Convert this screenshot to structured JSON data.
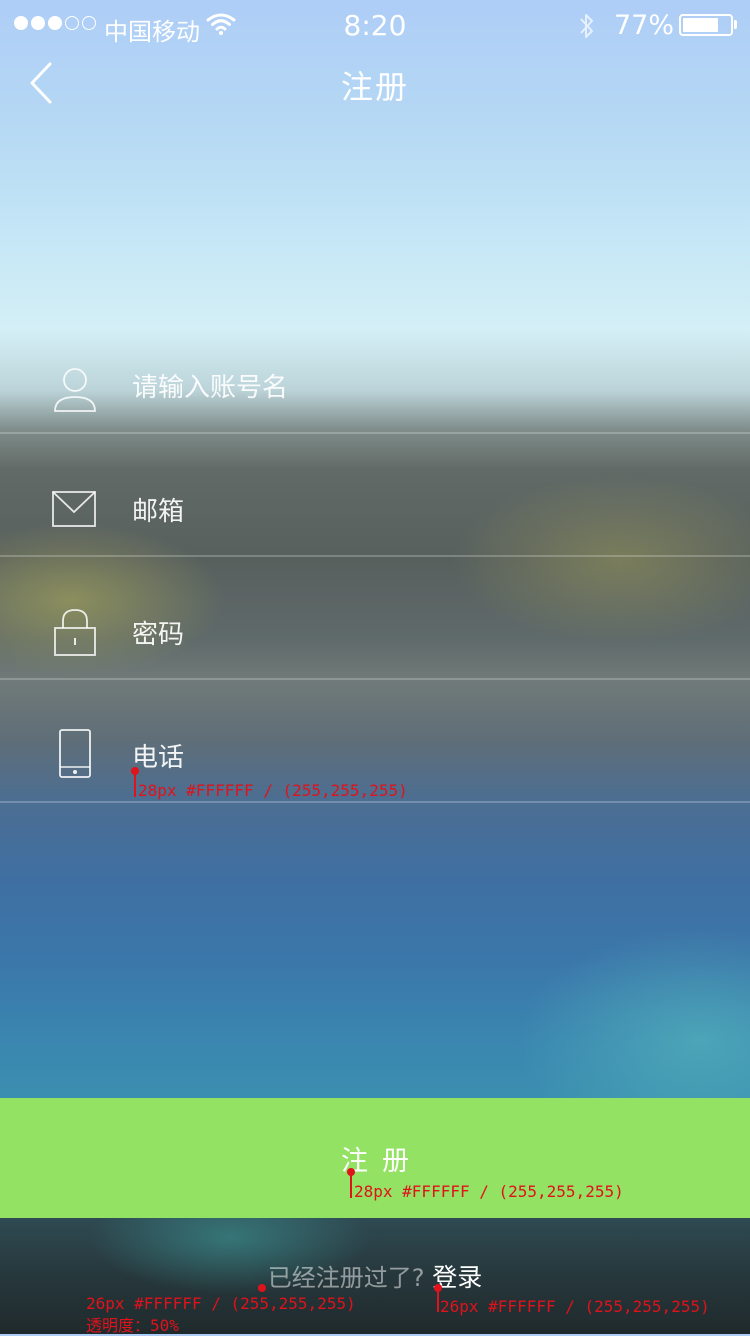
{
  "status_bar": {
    "signal_dots_filled": 3,
    "signal_dots_total": 5,
    "carrier": "中国移动",
    "time": "8:20",
    "battery_percent_text": "77%",
    "battery_level": 0.77
  },
  "nav": {
    "title": "注册",
    "back_icon": "chevron-left-icon"
  },
  "form": {
    "rows": [
      {
        "icon": "user-icon",
        "placeholder": "请输入账号名"
      },
      {
        "icon": "mail-icon",
        "placeholder": "邮箱"
      },
      {
        "icon": "lock-icon",
        "placeholder": "密码"
      },
      {
        "icon": "phone-icon",
        "placeholder": "电话"
      }
    ]
  },
  "register_button": {
    "label": "注册",
    "color": "#93E264"
  },
  "footer": {
    "already_text": "已经注册过了?",
    "login_label": "登录"
  },
  "annotations": {
    "phone_label": "28px #FFFFFF / (255,255,255)",
    "button_label": "28px #FFFFFF / (255,255,255)",
    "already_label": "26px #FFFFFF / (255,255,255)",
    "already_opacity": "透明度：50%",
    "login_label": "26px #FFFFFF / (255,255,255)",
    "color": "#E0121B"
  }
}
